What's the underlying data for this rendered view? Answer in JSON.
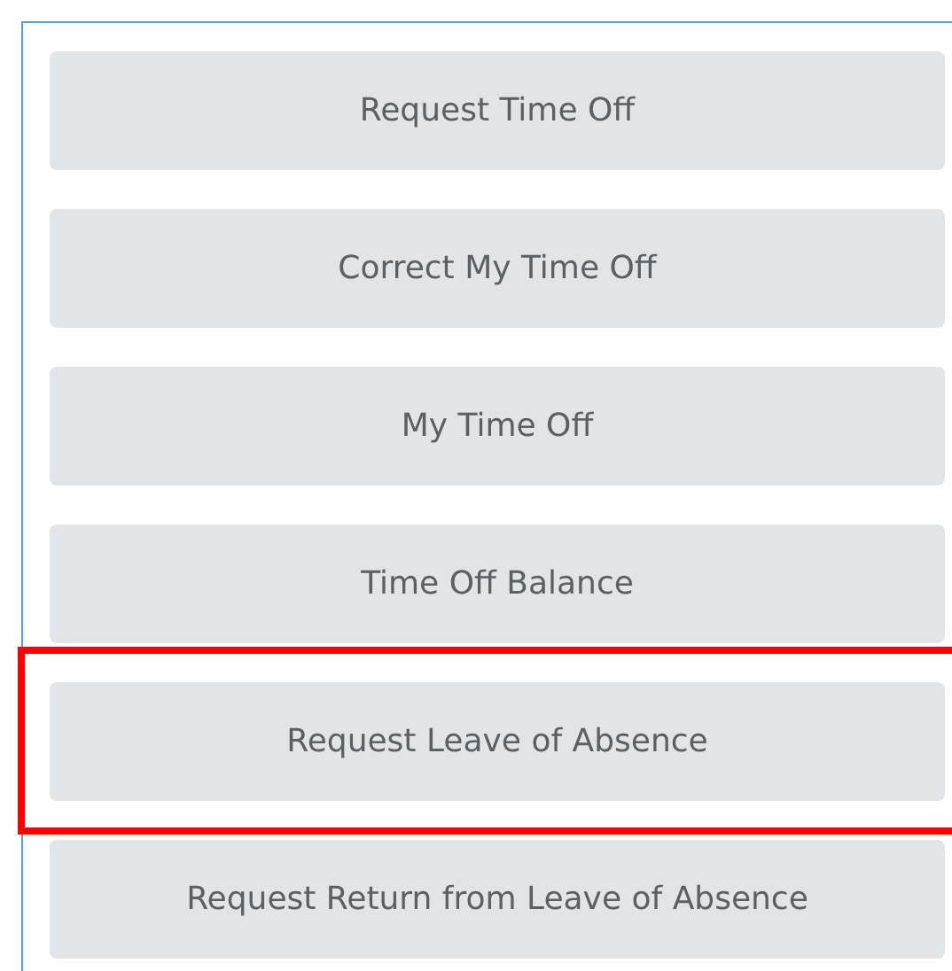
{
  "buttons": [
    {
      "label": "Request Time Off",
      "highlighted": false
    },
    {
      "label": "Correct My Time Off",
      "highlighted": false
    },
    {
      "label": "My Time Off",
      "highlighted": false
    },
    {
      "label": "Time Off Balance",
      "highlighted": false
    },
    {
      "label": "Request Leave of Absence",
      "highlighted": true
    },
    {
      "label": "Request Return from Leave of Absence",
      "highlighted": false
    }
  ]
}
